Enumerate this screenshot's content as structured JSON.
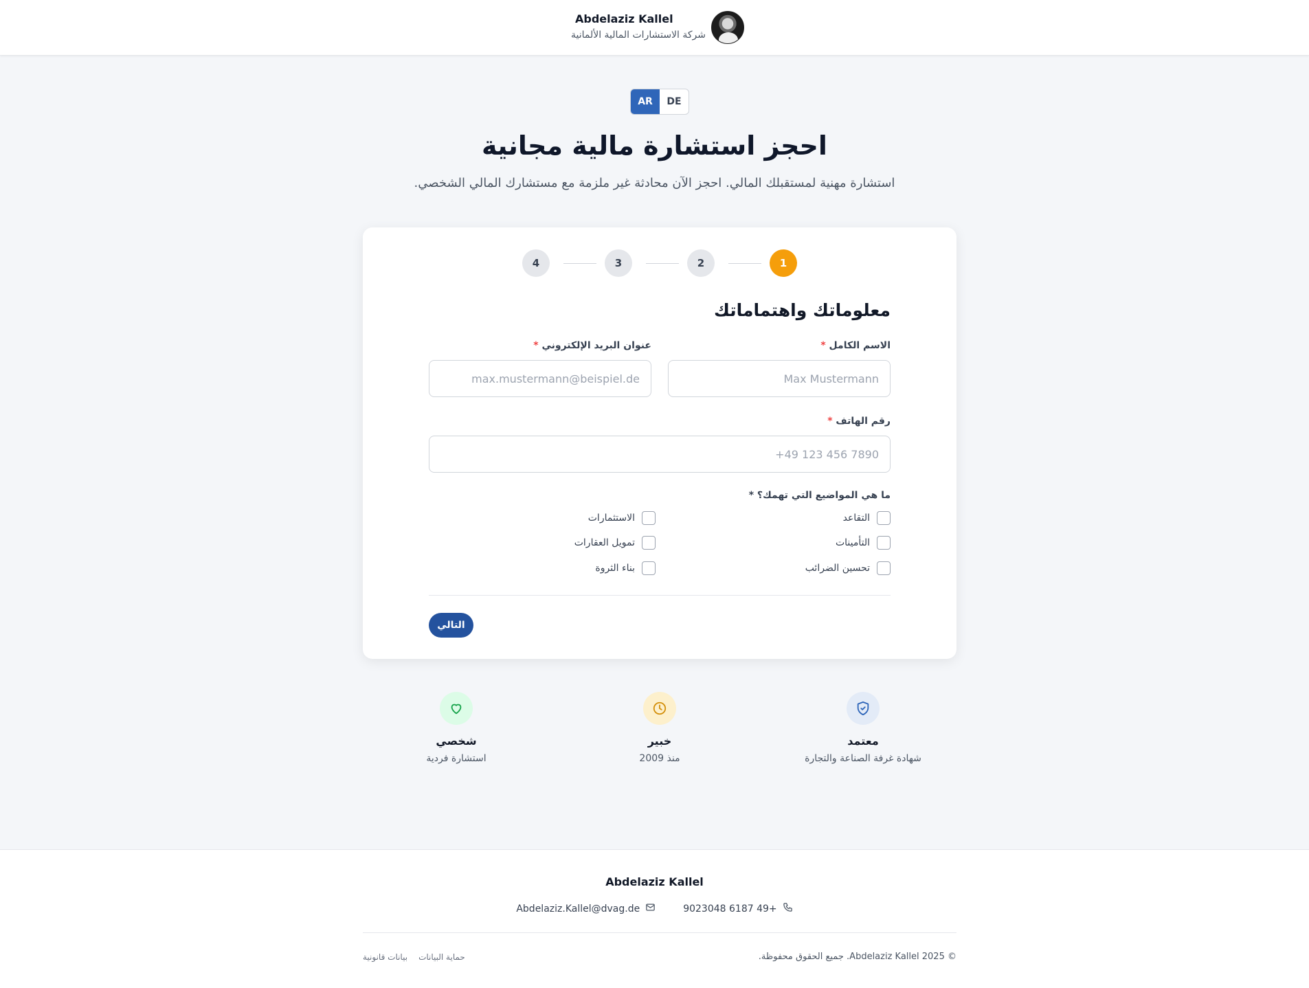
{
  "header": {
    "name": "Abdelaziz Kallel",
    "company": "شركة الاستشارات المالية الألمانية"
  },
  "language": {
    "options": [
      "AR",
      "DE"
    ],
    "selected": "AR"
  },
  "hero": {
    "title": "احجز استشارة مالية مجانية",
    "subtitle": "استشارة مهنية لمستقبلك المالي. احجز الآن محادثة غير ملزمة مع مستشارك المالي الشخصي."
  },
  "steps": {
    "items": [
      "1",
      "2",
      "3",
      "4"
    ],
    "active": "1"
  },
  "form": {
    "section_title": "معلوماتك واهتماماتك",
    "full_name": {
      "label": "الاسم الكامل",
      "placeholder": "Max Mustermann"
    },
    "email": {
      "label": "عنوان البريد الإلكتروني",
      "placeholder": "max.mustermann@beispiel.de"
    },
    "phone": {
      "label": "رقم الهاتف",
      "placeholder": "+49 123 456 7890"
    },
    "required_mark": "*",
    "topics_label": "ما هي المواضيع التي تهمك؟ *",
    "topics": [
      "التقاعد",
      "الاستثمارات",
      "التأمينات",
      "تمويل العقارات",
      "تحسين الضرائب",
      "بناء الثروة"
    ],
    "next_button": "التالي"
  },
  "features": [
    {
      "title": "معتمد",
      "subtitle": "شهادة غرفة الصناعة والتجارة",
      "icon": "shield-check-icon",
      "color": "#2f66b9",
      "bg": "#e3ebf7"
    },
    {
      "title": "خبير",
      "subtitle": "منذ 2009",
      "icon": "clock-icon",
      "color": "#d4900c",
      "bg": "#fdf0cc"
    },
    {
      "title": "شخصي",
      "subtitle": "استشارة فردية",
      "icon": "heart-icon",
      "color": "#16a34a",
      "bg": "#dcfce7"
    }
  ],
  "footer": {
    "name": "Abdelaziz Kallel",
    "phone": "9023048 6187 49+",
    "email": "Abdelaziz.Kallel@dvag.de",
    "copyright": "© Abdelaziz Kallel 2025. جميع الحقوق محفوظة.",
    "links": [
      "حماية البيانات",
      "بيانات قانونية"
    ]
  },
  "colors": {
    "primary": "#24529e",
    "accent": "#f59e0b",
    "required": "#ef4444"
  }
}
